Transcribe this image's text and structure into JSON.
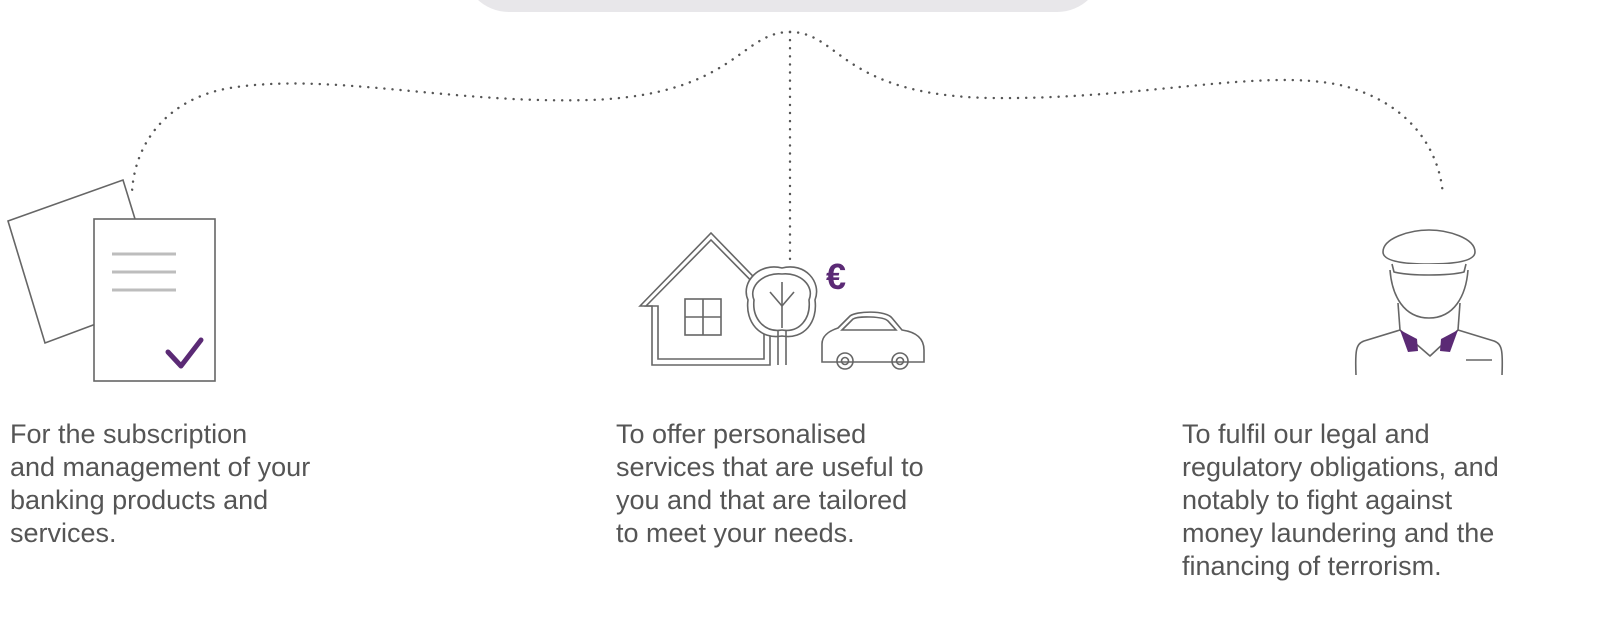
{
  "colors": {
    "accent": "#5b2a75",
    "line": "#666666",
    "doc_lines": "#bdbdbd",
    "bubble": "#e8e7ea",
    "text": "#555555"
  },
  "icons": [
    "documents-icon",
    "checkmark-icon",
    "house-icon",
    "tree-icon",
    "euro-icon",
    "car-icon",
    "officer-icon"
  ],
  "euro_symbol": "€",
  "captions": [
    {
      "lines": [
        "For the subscription",
        "and management of your",
        "banking products and",
        "services."
      ]
    },
    {
      "lines": [
        "To offer personalised",
        "services that are useful to",
        "you and that are tailored",
        "to meet your needs."
      ]
    },
    {
      "lines": [
        "To fulfil our legal and",
        "regulatory obligations, and",
        "notably to fight against",
        "money laundering and the",
        "financing of terrorism."
      ]
    }
  ]
}
